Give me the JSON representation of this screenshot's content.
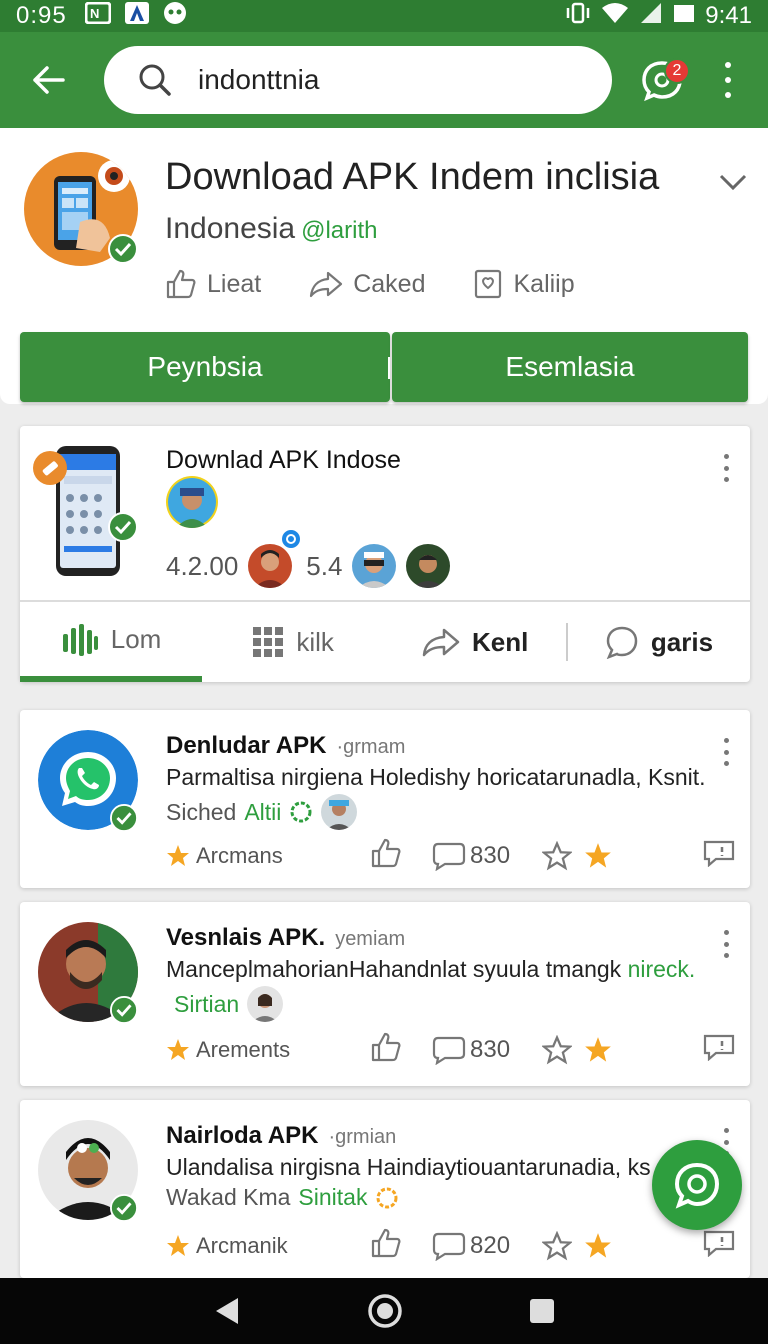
{
  "status_bar": {
    "time": "0:95",
    "right_time": "9:41",
    "left_icons": [
      "nfc-icon",
      "app-a-icon",
      "face-icon"
    ],
    "right_icons": [
      "vibrate-icon",
      "wifi-icon",
      "signal-icon",
      "battery-icon"
    ]
  },
  "app_bar": {
    "search_query": "indonttnia",
    "notification_count": "2"
  },
  "header": {
    "title": "Download APK Indem inclisia",
    "subtitle": "Indonesia",
    "handle": "@larith",
    "actions": [
      {
        "icon": "thumbs-up-icon",
        "label": "Lieat"
      },
      {
        "icon": "share-icon",
        "label": "Caked"
      },
      {
        "icon": "bookmark-icon",
        "label": "Kaliip"
      }
    ],
    "buttons": {
      "left": "Peynbsia",
      "right": "Esemlasia"
    }
  },
  "featured": {
    "title": "Downlad APK Indose",
    "rating": "4.2.00",
    "count": "5.4",
    "tabs": [
      {
        "label": "Lom",
        "icon": "bars-icon"
      },
      {
        "label": "kilk",
        "icon": "grid-icon"
      },
      {
        "label": "Kenl",
        "icon": "share-icon"
      },
      {
        "label": "garis",
        "icon": "comment-icon"
      }
    ]
  },
  "posts": [
    {
      "name": "Denludar APK",
      "sub": "·grmam",
      "body": "Parmaltisa nirgiena Holedishy horicatarunadla, Ksnit.",
      "body_green": "",
      "meta": "Siched",
      "meta_green": "Altii",
      "tag": "Arcmans",
      "comments": "830"
    },
    {
      "name": "Vesnlais APK.",
      "sub": "yemiam",
      "body": "ManceplmahorianHahandnlat syuula tmangk ",
      "body_green": "nireck.",
      "meta": "",
      "meta_green": "Sirtian",
      "tag": "Arements",
      "comments": "830"
    },
    {
      "name": "Nairloda APK",
      "sub": "·grmian",
      "body": "Ulandalisa nirgisna Haindiaytiouantarunadia, ks",
      "body_green": "",
      "meta": "Wakad Kma",
      "meta_green": "Sinitak",
      "tag": "Arcmanik",
      "comments": "820"
    }
  ],
  "colors": {
    "primary": "#3a8f3d",
    "status_bar": "#2e7d32",
    "accent_green": "#2e9e3e",
    "star": "#f5a623",
    "badge": "#e53935"
  }
}
